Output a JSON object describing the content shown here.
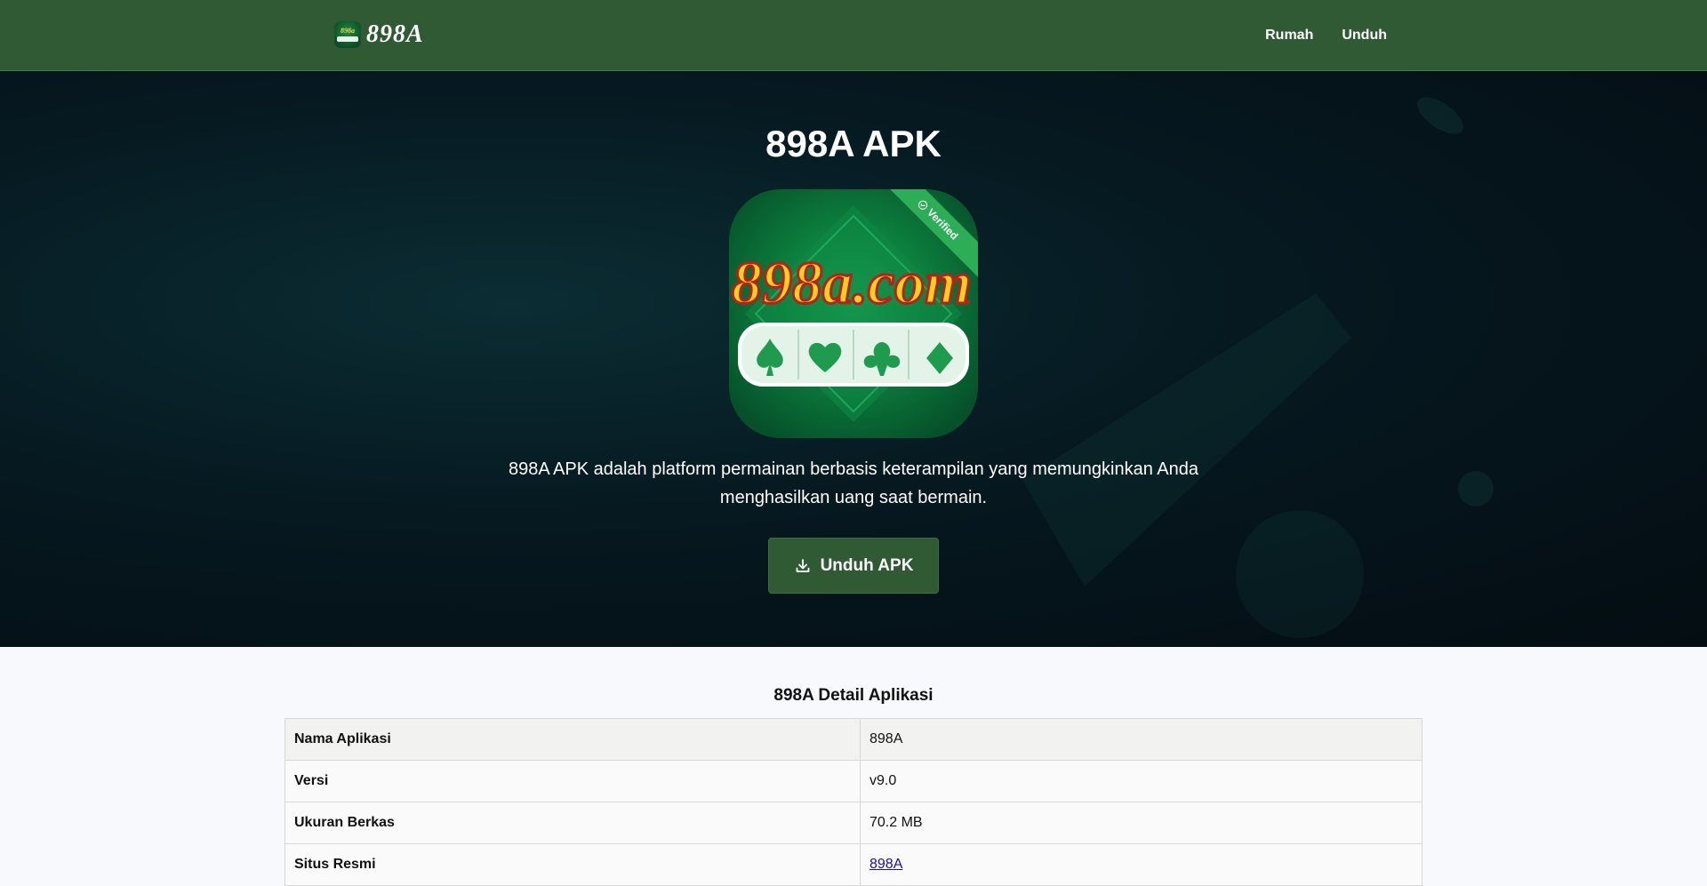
{
  "header": {
    "logo_text": "898A",
    "nav": [
      {
        "label": "Rumah"
      },
      {
        "label": "Unduh"
      }
    ]
  },
  "hero": {
    "title": "898A APK",
    "icon_text": "898a.com",
    "verified_label": "Verified",
    "description": "898A APK adalah platform permainan berbasis keterampilan yang memungkinkan Anda menghasilkan uang saat bermain.",
    "download_label": "Unduh APK"
  },
  "details": {
    "title": "898A Detail Aplikasi",
    "rows": [
      {
        "key": "Nama Aplikasi",
        "value": "898A"
      },
      {
        "key": "Versi",
        "value": "v9.0"
      },
      {
        "key": "Ukuran Berkas",
        "value": "70.2 MB"
      },
      {
        "key": "Situs Resmi",
        "value": "898A"
      }
    ]
  },
  "colors": {
    "header_bg": "#2f5a34",
    "accent_green": "#2dae56",
    "link": "#1a0dab"
  },
  "icons": [
    "download-icon",
    "verified-check-icon",
    "spade-icon",
    "heart-icon",
    "club-icon",
    "diamond-icon"
  ]
}
